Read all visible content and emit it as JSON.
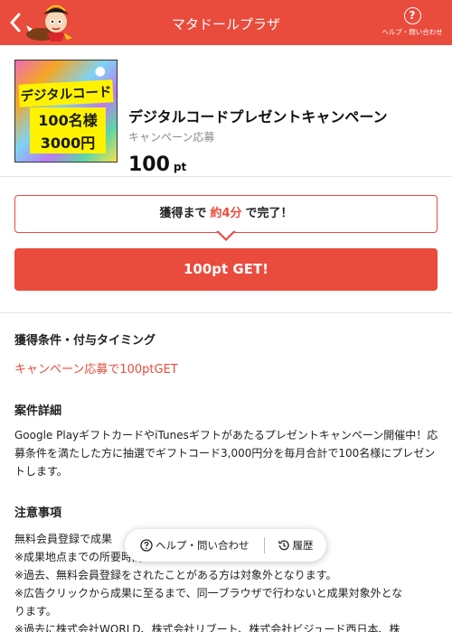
{
  "header": {
    "title": "マタドールプラザ",
    "help_label": "ヘルプ・問い合わせ"
  },
  "product": {
    "image_text": {
      "line1": "デジタルコード",
      "line2": "100名様",
      "line3": "3000円"
    },
    "title": "デジタルコードプレゼントキャンペーン",
    "subtitle": "キャンペーン応募",
    "points": "100",
    "points_unit": "pt"
  },
  "completion": {
    "prefix": "獲得まで",
    "time": "約4分",
    "suffix": "で完了！"
  },
  "get_button": "100pt GET!",
  "sections": {
    "conditions_heading": "獲得条件・付与タイミング",
    "conditions_text": "キャンペーン応募で100ptGET",
    "details_heading": "案件詳細",
    "details_text": "Google PlayギフトカードやiTunesギフトがあたるプレゼントキャンペーン開催中！応募条件を満たした方に抽選でギフトコード3,000円分を毎月合計で100名様にプレゼントします。",
    "notes_heading": "注意事項",
    "notes": [
      "無料会員登録で成果",
      "※成果地点までの所要時間：約",
      "※過去、無料会員登録をされたことがある方は対象外となります。",
      "※広告クリックから成果に至るまで、同一ブラウザで行わないと成果対象外とな",
      "ります。",
      "※過去に株式会社WORLD、株式会社リブート、株式会社ビジュード西日本、株"
    ]
  },
  "floating_bar": {
    "help_label": "ヘルプ・問い合わせ",
    "history_label": "履歴"
  },
  "colors": {
    "accent": "#e94b3c"
  }
}
